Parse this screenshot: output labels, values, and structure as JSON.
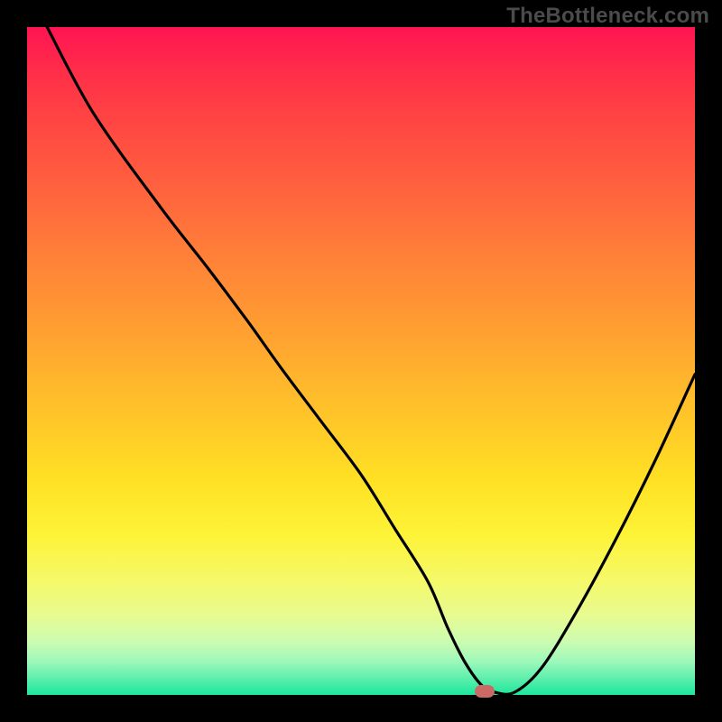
{
  "watermark": "TheBottleneck.com",
  "chart_data": {
    "type": "line",
    "title": "",
    "xlabel": "",
    "ylabel": "",
    "xlim": [
      0,
      100
    ],
    "ylim": [
      0,
      100
    ],
    "grid": false,
    "legend": false,
    "series": [
      {
        "name": "bottleneck-curve",
        "x": [
          3,
          10,
          20,
          27,
          33,
          38,
          44,
          50,
          55,
          60,
          63,
          65.5,
          68,
          70,
          73,
          77,
          82,
          88,
          94,
          100
        ],
        "y": [
          100,
          87,
          73,
          64,
          56,
          49,
          41,
          33,
          25,
          17,
          10,
          5,
          1.5,
          0.4,
          0.4,
          4,
          12,
          23,
          35,
          48
        ]
      }
    ],
    "marker": {
      "x": 68.5,
      "y": 0.6
    },
    "colors": {
      "curve": "#000000",
      "marker": "#c96a65",
      "gradient_top": "#ff1452",
      "gradient_bottom": "#1ce79c"
    }
  }
}
